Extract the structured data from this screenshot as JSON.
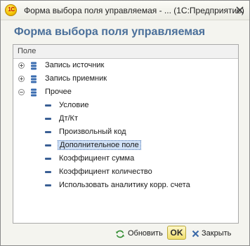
{
  "window": {
    "logo_text": "1С",
    "title": "Форма выбора поля управляемая - ... (1С:Предприятие)"
  },
  "form": {
    "header": "Форма выбора поля управляемая"
  },
  "tree": {
    "column_header": "Поле",
    "groups": [
      {
        "label": "Запись источник",
        "state": "collapsed"
      },
      {
        "label": "Запись приемник",
        "state": "collapsed"
      },
      {
        "label": "Прочее",
        "state": "expanded"
      }
    ],
    "items": [
      {
        "label": "Условие"
      },
      {
        "label": "Дт/Кт"
      },
      {
        "label": "Произвольный код"
      },
      {
        "label": "Дополнительное поле",
        "selected": true
      },
      {
        "label": "Коэффициент сумма"
      },
      {
        "label": "Коэффициент количество"
      },
      {
        "label": "Использовать аналитику корр. счета"
      }
    ]
  },
  "footer": {
    "refresh_label": "Обновить",
    "ok_label": "OK",
    "close_label": "Закрыть"
  },
  "colors": {
    "header_text": "#4a6f9a",
    "ok_button": "#f0de6e",
    "selection": "#cfe0f6"
  }
}
